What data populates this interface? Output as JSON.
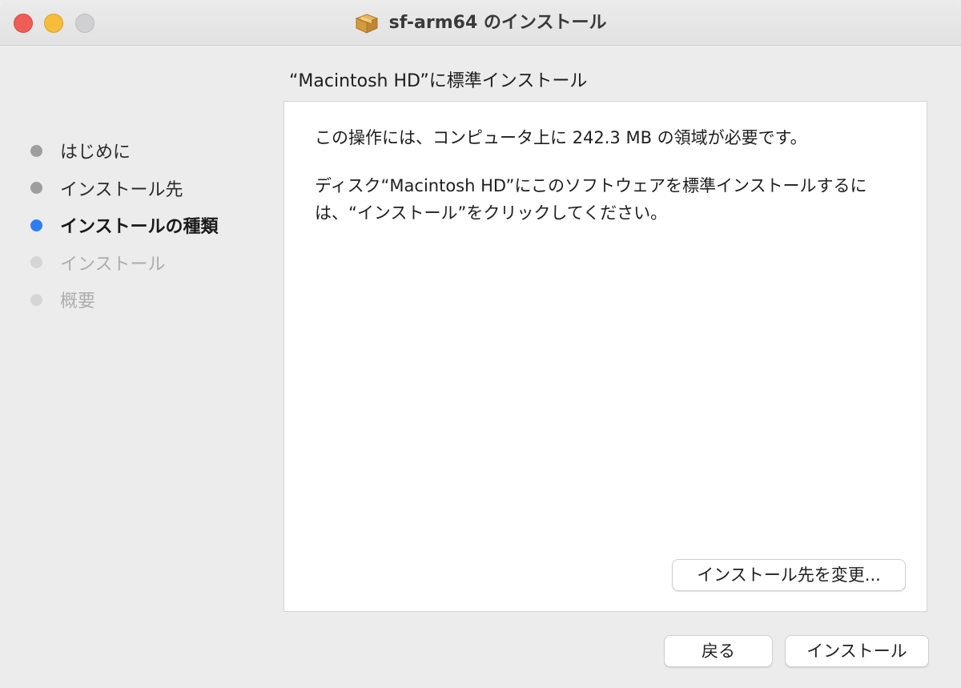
{
  "window": {
    "title": "sf-arm64 のインストール",
    "icon": "package-icon"
  },
  "header": {
    "title": "“Macintosh HD”に標準インストール"
  },
  "sidebar": {
    "steps": [
      {
        "label": "はじめに",
        "state": "done"
      },
      {
        "label": "インストール先",
        "state": "done"
      },
      {
        "label": "インストールの種類",
        "state": "current"
      },
      {
        "label": "インストール",
        "state": "pending"
      },
      {
        "label": "概要",
        "state": "pending"
      }
    ]
  },
  "content": {
    "paragraph1": "この操作には、コンピュータ上に 242.3 MB の領域が必要です。",
    "paragraph2": "ディスク“Macintosh HD”にこのソフトウェアを標準インストールするには、“インストール”をクリックしてください。"
  },
  "buttons": {
    "change_location": "インストール先を変更...",
    "back": "戻る",
    "install": "インストール"
  },
  "colors": {
    "current_step": "#2f7cf6",
    "close": "#ee5e56",
    "minimize": "#f6bd3b",
    "zoom": "#d0cfd1"
  }
}
